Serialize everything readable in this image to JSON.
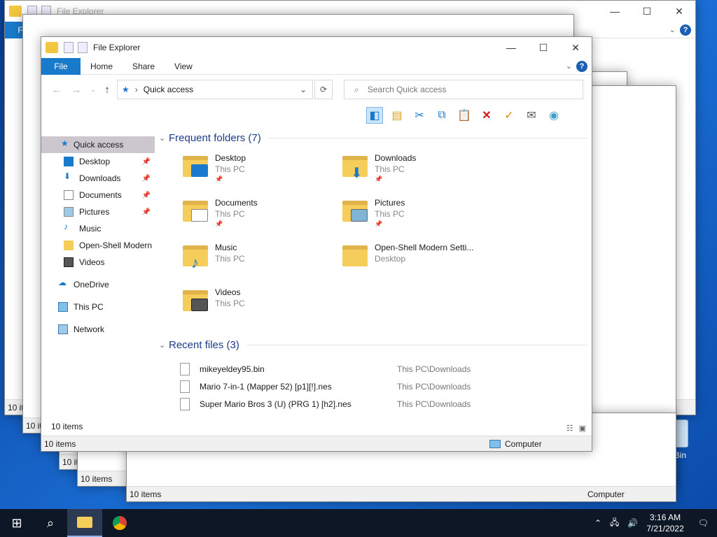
{
  "app": {
    "title": "File Explorer"
  },
  "ribbon": {
    "file": "File",
    "home": "Home",
    "share": "Share",
    "view": "View",
    "help": "?"
  },
  "address": {
    "location": "Quick access",
    "search_placeholder": "Search Quick access"
  },
  "nav": {
    "items": [
      {
        "label": "Quick access",
        "icon": "star-icon"
      },
      {
        "label": "Desktop",
        "icon": "desktop-icon",
        "pinned": true
      },
      {
        "label": "Downloads",
        "icon": "download-arrow-icon",
        "pinned": true
      },
      {
        "label": "Documents",
        "icon": "document-icon",
        "pinned": true
      },
      {
        "label": "Pictures",
        "icon": "picture-icon",
        "pinned": true
      },
      {
        "label": "Music",
        "icon": "music-note-icon"
      },
      {
        "label": "Open-Shell Modern",
        "icon": "folder-icon"
      },
      {
        "label": "Videos",
        "icon": "film-icon"
      },
      {
        "label": "OneDrive",
        "icon": "cloud-icon"
      },
      {
        "label": "This PC",
        "icon": "computer-icon"
      },
      {
        "label": "Network",
        "icon": "network-icon"
      }
    ]
  },
  "frequent": {
    "header": "Frequent folders (7)",
    "items": [
      {
        "name": "Desktop",
        "sub": "This PC"
      },
      {
        "name": "Downloads",
        "sub": "This PC"
      },
      {
        "name": "Documents",
        "sub": "This PC"
      },
      {
        "name": "Pictures",
        "sub": "This PC"
      },
      {
        "name": "Music",
        "sub": "This PC"
      },
      {
        "name": "Open-Shell Modern Setti...",
        "sub": "Desktop"
      },
      {
        "name": "Videos",
        "sub": "This PC"
      }
    ]
  },
  "recent": {
    "header": "Recent files (3)",
    "items": [
      {
        "name": "mikeyeldey95.bin",
        "location": "This PC\\Downloads"
      },
      {
        "name": "Mario 7-in-1 (Mapper 52) [p1][!].nes",
        "location": "This PC\\Downloads"
      },
      {
        "name": "Super Mario Bros 3 (U) (PRG 1) [h2].nes",
        "location": "This PC\\Downloads"
      }
    ]
  },
  "status": {
    "items": "10 items",
    "computer": "Computer"
  },
  "bg_windows": {
    "items": "10 items",
    "computer": "Computer",
    "partial_computer": "puter"
  },
  "desktop": {
    "recycle_label": "ycle Bin"
  },
  "taskbar": {
    "time": "3:16 AM",
    "date": "7/21/2022"
  },
  "colors": {
    "accent": "#1979ca",
    "section": "#1e3c87",
    "taskbar": "#0e1726"
  }
}
